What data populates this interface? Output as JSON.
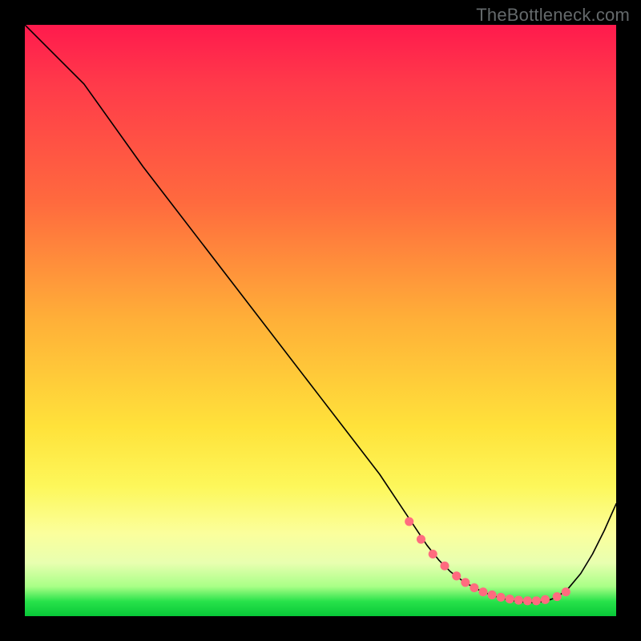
{
  "watermark": "TheBottleneck.com",
  "chart_data": {
    "type": "line",
    "title": "",
    "xlabel": "",
    "ylabel": "",
    "xlim": [
      0,
      100
    ],
    "ylim": [
      0,
      100
    ],
    "grid": false,
    "series": [
      {
        "name": "curve",
        "x": [
          0,
          6,
          10,
          20,
          30,
          40,
          50,
          60,
          64,
          68,
          70,
          72,
          74,
          76,
          78,
          80,
          82,
          84,
          86,
          88,
          90,
          92,
          94,
          96,
          98,
          100
        ],
        "y": [
          100,
          94,
          90,
          76,
          63,
          50,
          37,
          24,
          18,
          12,
          9.5,
          7.5,
          6,
          4.8,
          3.9,
          3.2,
          2.7,
          2.4,
          2.3,
          2.5,
          3.2,
          4.8,
          7.2,
          10.5,
          14.5,
          19
        ]
      }
    ],
    "markers": {
      "name": "highlight-points",
      "color": "#ff6b7f",
      "x": [
        65,
        67,
        69,
        71,
        73,
        74.5,
        76,
        77.5,
        79,
        80.5,
        82,
        83.5,
        85,
        86.5,
        88,
        90,
        91.5
      ],
      "y": [
        16,
        13,
        10.5,
        8.5,
        6.8,
        5.7,
        4.8,
        4.1,
        3.6,
        3.2,
        2.9,
        2.7,
        2.6,
        2.6,
        2.8,
        3.3,
        4.1
      ]
    }
  }
}
